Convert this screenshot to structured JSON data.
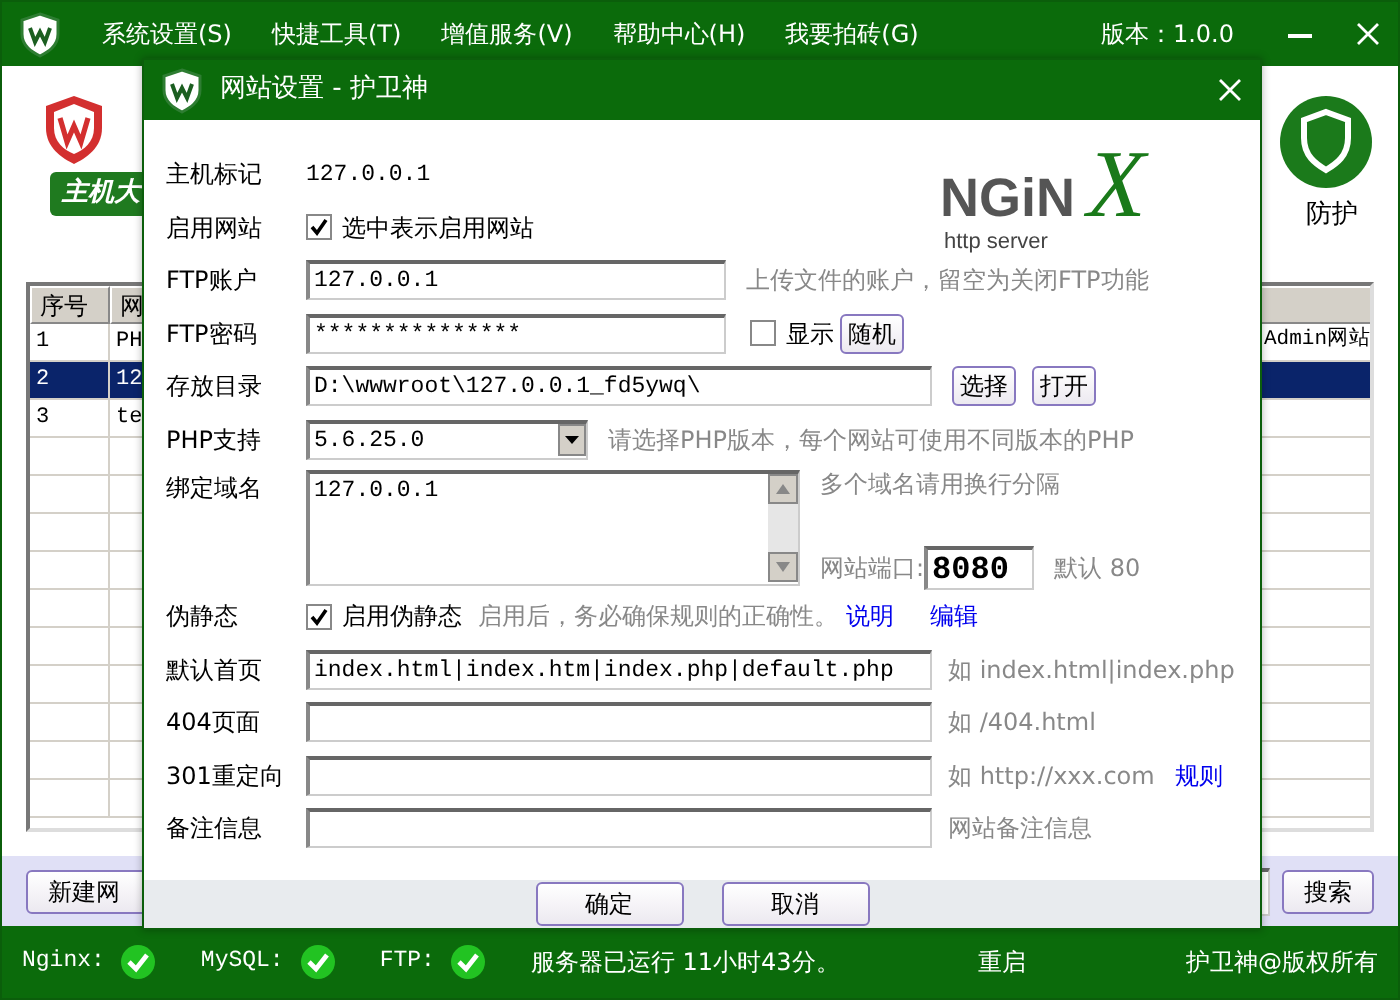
{
  "app": {
    "menu": [
      "系统设置(S)",
      "快捷工具(T)",
      "增值服务(V)",
      "帮助中心(H)",
      "我要拍砖(G)"
    ],
    "version": "版本：1.0.0",
    "badge": "主机大",
    "feature_label": "防护",
    "table": {
      "columns": [
        "序号",
        "网"
      ],
      "rows": [
        {
          "number": "1",
          "site": "PH",
          "extra": "Admin网站",
          "selected": false
        },
        {
          "number": "2",
          "site": "12",
          "extra": "",
          "selected": true
        },
        {
          "number": "3",
          "site": "te",
          "extra": "",
          "selected": false
        }
      ]
    },
    "new_button": "新建网",
    "search_button": "搜索"
  },
  "dialog": {
    "title": "网站设置 - 护卫神",
    "logo": {
      "name": "NGiN",
      "mark": "X",
      "tagline": "http server"
    },
    "rows": [
      {
        "kind": "text",
        "label": "主机标记",
        "value": "127.0.0.1"
      },
      {
        "kind": "checkbox",
        "label": "启用网站",
        "checked": true,
        "text": "选中表示启用网站"
      },
      {
        "kind": "account",
        "label": "FTP账户",
        "value": "127.0.0.1",
        "hint": "上传文件的账户，留空为关闭FTP功能"
      },
      {
        "kind": "password",
        "label": "FTP密码",
        "value": "***************",
        "show_label": "显示",
        "show_checked": false,
        "button": "随机"
      },
      {
        "kind": "path",
        "label": "存放目录",
        "value": "D:\\wwwroot\\127.0.0.1_fd5ywq\\",
        "buttons": [
          "选择",
          "打开"
        ]
      },
      {
        "kind": "select",
        "label": "PHP支持",
        "value": "5.6.25.0",
        "hint": "请选择PHP版本，每个网站可使用不同版本的PHP"
      },
      {
        "kind": "domains",
        "label": "绑定域名",
        "value": "127.0.0.1",
        "hint": "多个域名请用换行分隔",
        "port_label": "网站端口:",
        "port": "8080",
        "port_default": "默认 80"
      },
      {
        "kind": "rewrite",
        "label": "伪静态",
        "checked": true,
        "text": "启用伪静态",
        "hint": "启用后，务必确保规则的正确性。",
        "links": [
          "说明",
          "编辑"
        ]
      },
      {
        "kind": "field",
        "label": "默认首页",
        "value": "index.html|index.htm|index.php|default.php",
        "hint": "如 index.html|index.php"
      },
      {
        "kind": "field",
        "label": "404页面",
        "value": "",
        "hint": "如 /404.html"
      },
      {
        "kind": "field",
        "label": "301重定向",
        "value": "",
        "hint": "如 http://xxx.com",
        "link": "规则"
      },
      {
        "kind": "field",
        "label": "备注信息",
        "value": "",
        "hint": "网站备注信息"
      }
    ],
    "buttons": [
      "确定",
      "取消"
    ]
  },
  "status_bar": {
    "services": [
      {
        "label": "Nginx:",
        "ok": true
      },
      {
        "label": "MySQL:",
        "ok": true
      },
      {
        "label": "FTP:",
        "ok": true
      }
    ],
    "uptime": "服务器已运行 11小时43分。",
    "restart": "重启",
    "copyright": "护卫神@版权所有"
  }
}
